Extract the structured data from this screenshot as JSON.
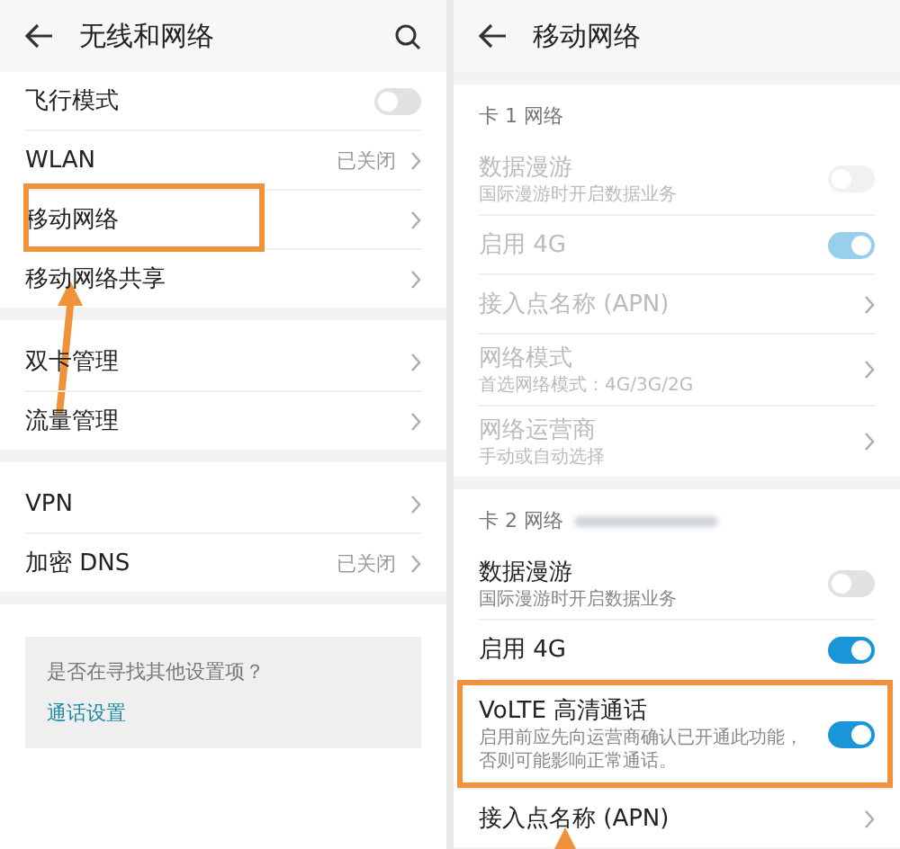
{
  "screens": [
    {
      "title": "无线和网络",
      "search": true,
      "groups": [
        {
          "rows": [
            {
              "kind": "toggle",
              "label": "飞行模式",
              "on": false,
              "disabled": false,
              "highlighted": false
            },
            {
              "kind": "link",
              "label": "WLAN",
              "value": "已关闭",
              "disabled": false,
              "highlighted": false
            },
            {
              "kind": "link",
              "label": "移动网络",
              "disabled": false,
              "highlighted": true
            },
            {
              "kind": "link",
              "label": "移动网络共享",
              "disabled": false,
              "highlighted": false
            }
          ]
        },
        {
          "rows": [
            {
              "kind": "link",
              "label": "双卡管理",
              "disabled": false,
              "highlighted": false
            },
            {
              "kind": "link",
              "label": "流量管理",
              "disabled": false,
              "highlighted": false
            }
          ]
        },
        {
          "rows": [
            {
              "kind": "link",
              "label": "VPN",
              "disabled": false,
              "highlighted": false
            },
            {
              "kind": "link",
              "label": "加密 DNS",
              "value": "已关闭",
              "disabled": false,
              "highlighted": false
            }
          ]
        }
      ],
      "suggestion": {
        "question": "是否在寻找其他设置项？",
        "link": "通话设置"
      }
    },
    {
      "title": "移动网络",
      "groups": [
        {
          "heading": "卡 1 网络",
          "rows": [
            {
              "kind": "toggle",
              "label": "数据漫游",
              "detail": "国际漫游时开启数据业务",
              "on": false,
              "disabled": true,
              "highlighted": false
            },
            {
              "kind": "toggle",
              "label": "启用 4G",
              "on": true,
              "disabled": true,
              "highlighted": false
            },
            {
              "kind": "link",
              "label": "接入点名称 (APN)",
              "disabled": true,
              "highlighted": false
            },
            {
              "kind": "link",
              "label": "网络模式",
              "detail": "首选网络模式：4G/3G/2G",
              "disabled": true,
              "highlighted": false
            },
            {
              "kind": "link",
              "label": "网络运营商",
              "detail": "手动或自动选择",
              "disabled": true,
              "highlighted": false
            }
          ]
        },
        {
          "heading": "卡 2 网络",
          "redacted": true,
          "rows": [
            {
              "kind": "toggle",
              "label": "数据漫游",
              "detail": "国际漫游时开启数据业务",
              "on": false,
              "disabled": false,
              "highlighted": false
            },
            {
              "kind": "toggle",
              "label": "启用 4G",
              "on": true,
              "disabled": false,
              "highlighted": false
            },
            {
              "kind": "toggle",
              "label": "VoLTE 高清通话",
              "detail": "启用前应先向运营商确认已开通此功能，否则可能影响正常通话。",
              "on": true,
              "disabled": false,
              "highlighted": true
            },
            {
              "kind": "link",
              "label": "接入点名称 (APN)",
              "disabled": false,
              "highlighted": false
            }
          ]
        }
      ]
    }
  ]
}
